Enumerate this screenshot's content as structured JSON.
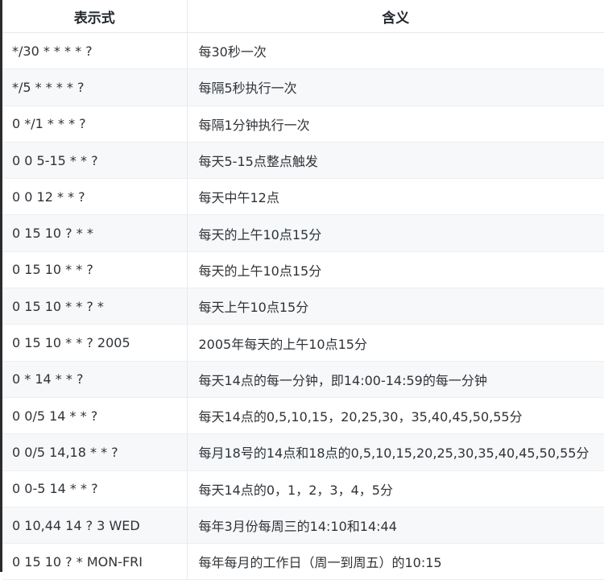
{
  "table": {
    "headers": {
      "expression": "表示式",
      "meaning": "含义"
    },
    "rows": [
      {
        "expression": "*/30 * * * * ?",
        "meaning": "每30秒一次"
      },
      {
        "expression": "*/5 * * * * ?",
        "meaning": "每隔5秒执行一次"
      },
      {
        "expression": "0 */1 * * * ?",
        "meaning": "每隔1分钟执行一次"
      },
      {
        "expression": "0 0 5-15 * * ?",
        "meaning": "每天5-15点整点触发"
      },
      {
        "expression": "0 0 12 * * ?",
        "meaning": "每天中午12点"
      },
      {
        "expression": "0 15 10 ? * *",
        "meaning": "每天的上午10点15分"
      },
      {
        "expression": "0 15 10 * * ?",
        "meaning": "每天的上午10点15分"
      },
      {
        "expression": "0 15 10 * * ? *",
        "meaning": "每天上午10点15分"
      },
      {
        "expression": "0 15 10 * * ? 2005",
        "meaning": "2005年每天的上午10点15分"
      },
      {
        "expression": "0 * 14 * * ?",
        "meaning": "每天14点的每一分钟，即14:00-14:59的每一分钟"
      },
      {
        "expression": "0 0/5 14 * * ?",
        "meaning": "每天14点的0,5,10,15，20,25,30，35,40,45,50,55分"
      },
      {
        "expression": "0 0/5 14,18 * * ?",
        "meaning": "每月18号的14点和18点的0,5,10,15,20,25,30,35,40,45,50,55分"
      },
      {
        "expression": "0 0-5 14 * * ?",
        "meaning": "每天14点的0，1，2，3，4，5分"
      },
      {
        "expression": "0 10,44 14 ? 3 WED",
        "meaning": "每年3月份每周三的14:10和14:44"
      },
      {
        "expression": "0 15 10 ? * MON-FRI",
        "meaning": "每年每月的工作日（周一到周五）的10:15"
      }
    ]
  }
}
